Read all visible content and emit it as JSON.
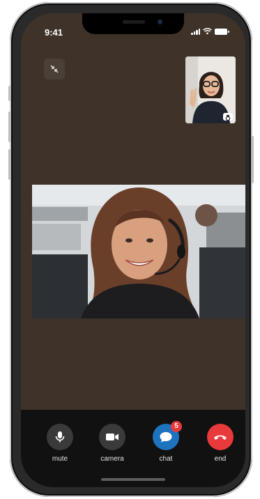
{
  "status_bar": {
    "time": "9:41"
  },
  "controls": [
    {
      "id": "mute",
      "label": "mute",
      "icon": "microphone-icon",
      "color": "#3a3a3a"
    },
    {
      "id": "camera",
      "label": "camera",
      "icon": "video-camera-icon",
      "color": "#3a3a3a"
    },
    {
      "id": "chat",
      "label": "chat",
      "icon": "chat-bubble-icon",
      "color": "#1e73be",
      "badge": "5"
    },
    {
      "id": "end",
      "label": "end",
      "icon": "end-call-icon",
      "color": "#e8393b"
    }
  ],
  "colors": {
    "call_background": "#3e3229",
    "controls_bar": "#111111",
    "chat_accent": "#1e73be",
    "end_call": "#e8393b"
  }
}
